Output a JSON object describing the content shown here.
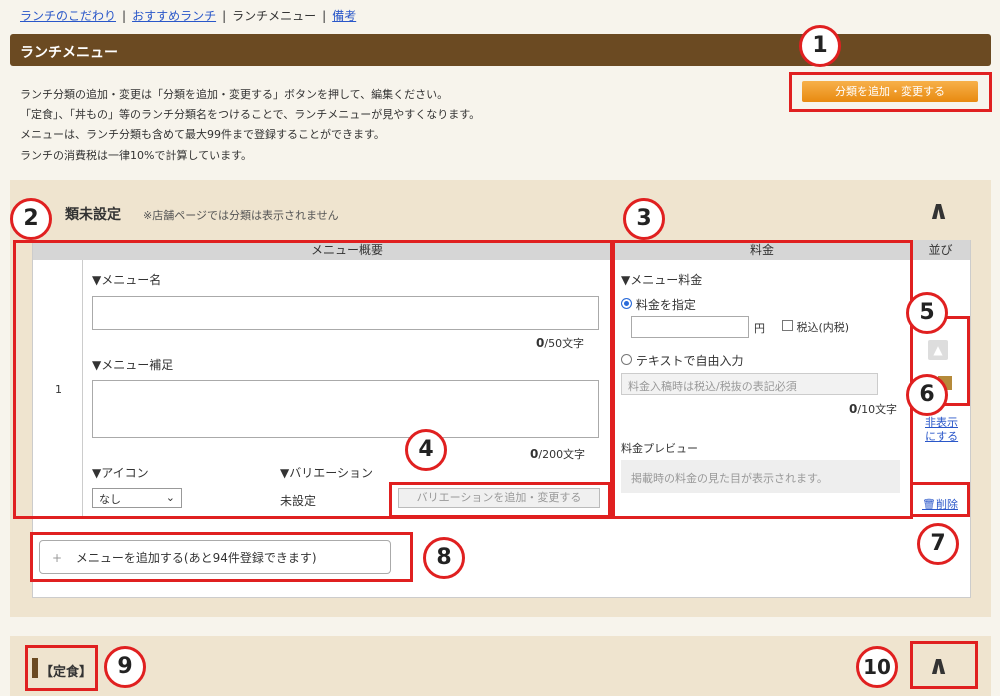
{
  "breadcrumb": {
    "item1": "ランチのこだわり",
    "item2": "おすすめランチ",
    "item3": "ランチメニュー",
    "item4": "備考",
    "sep": "|"
  },
  "page_title": "ランチメニュー",
  "notes": [
    "ランチ分類の追加・変更は「分類を追加・変更する」ボタンを押して、編集ください。",
    "「定食」、「丼もの」等のランチ分類名をつけることで、ランチメニューが見やすくなります。",
    "メニューは、ランチ分類も含めて最大99件まで登録することができます。",
    "ランチの消費税は一律10%で計算しています。"
  ],
  "add_category_button": "分類を追加・変更する",
  "section": {
    "title": "類未設定",
    "subtitle": "※店舗ページでは分類は表示されません",
    "chevron": "∧"
  },
  "table": {
    "col_overview": "メニュー概要",
    "col_price": "料金",
    "col_order": "並び",
    "row_number": "1"
  },
  "menu": {
    "name_label": "▼メニュー名",
    "name_counter_num": "0",
    "name_counter_unit": "/50文字",
    "supplement_label": "▼メニュー補足",
    "supplement_counter_num": "0",
    "supplement_counter_unit": "/200文字",
    "icon_label": "▼アイコン",
    "icon_value": "なし",
    "variation_label": "▼バリエーション",
    "variation_value": "未設定",
    "variation_button": "バリエーションを追加・変更する"
  },
  "price": {
    "label": "▼メニュー料金",
    "option_specify": "料金を指定",
    "yen": "円",
    "tax_included": "税込(内税)",
    "option_free_text": "テキストで自由入力",
    "free_text_placeholder": "料金入稿時は税込/税抜の表記必須",
    "counter_num": "0",
    "counter_unit": "/10文字",
    "preview_label": "料金プレビュー",
    "preview_text": "掲載時の料金の見た目が表示されます。"
  },
  "order": {
    "hide_link_line1": "非表示",
    "hide_link_line2": "にする",
    "delete_link": "削除"
  },
  "add_menu_button": "メニューを追加する(あと94件登録できます)",
  "section2": {
    "title": "【定食】",
    "chevron": "∧"
  },
  "annotations": {
    "c1": "1",
    "c2": "2",
    "c3": "3",
    "c4": "4",
    "c5": "5",
    "c6": "6",
    "c7": "7",
    "c8": "8",
    "c9": "9",
    "c10": "10"
  },
  "colors": {
    "title_bar": "#6b4a22",
    "accent_orange": "#e88a10",
    "annotation_red": "#e02020",
    "section_bg": "#efe4cf",
    "link_blue": "#2a57c9"
  }
}
